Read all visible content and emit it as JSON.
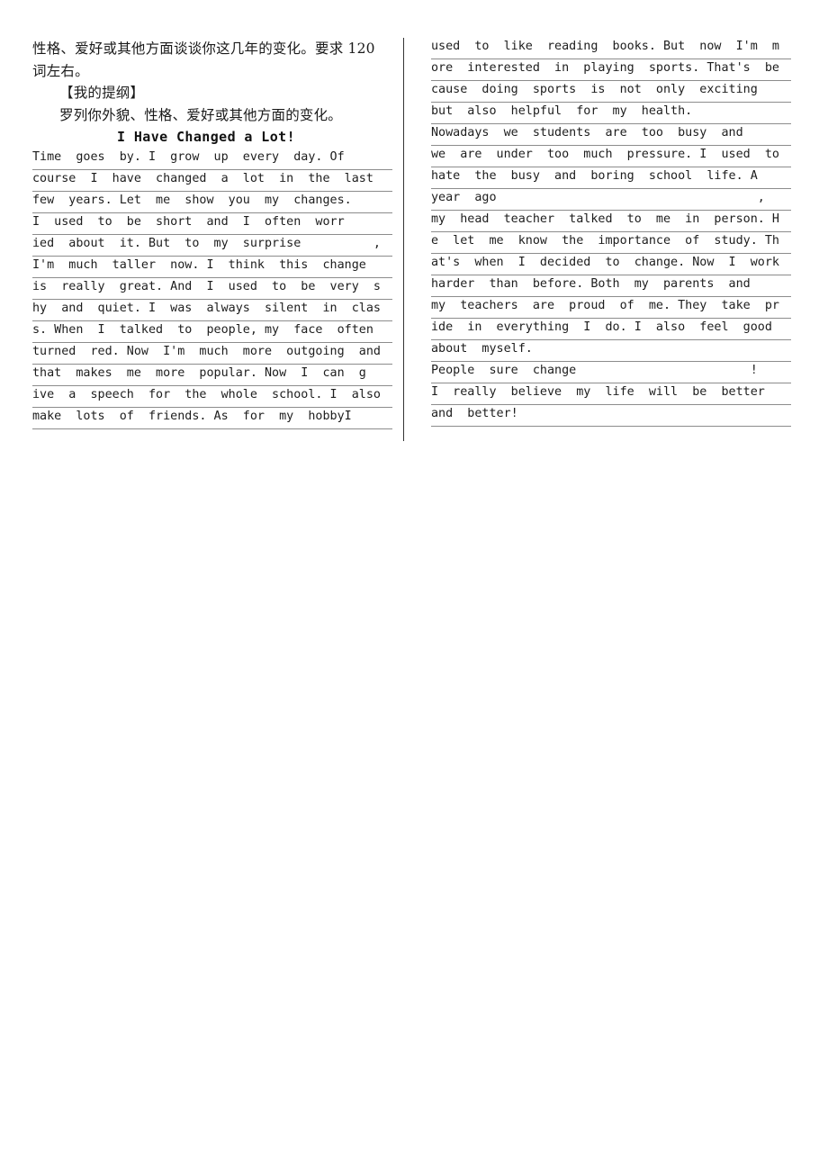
{
  "document": {
    "prompt": {
      "lines": [
        "性格、爱好或其他方面谈谈你这几年的变化。要求 120",
        "词左右。"
      ],
      "outline_heading": "【我的提纲】",
      "outline_text": "罗列你外貌、性格、爱好或其他方面的变化。"
    },
    "essay_title": "I Have Changed a Lot!",
    "left_column_lines": [
      "Time  goes  by. I  grow  up  every  day. Of",
      "course  I  have  changed  a  lot  in  the  last",
      "few  years. Let  me  show  you  my  changes.",
      "I  used  to  be  short  and  I  often  worr",
      "ied  about  it. But  to  my  surprise          ,",
      "I'm  much  taller  now. I  think  this  change",
      "is  really  great. And  I  used  to  be  very  s",
      "hy  and  quiet. I  was  always  silent  in  clas",
      "s. When  I  talked  to  people, my  face  often",
      "turned  red. Now  I'm  much  more  outgoing  and",
      "that  makes  me  more  popular. Now  I  can  g",
      "ive  a  speech  for  the  whole  school. I  also",
      "make  lots  of  friends. As  for  my  hobbyI"
    ],
    "right_column_lines": [
      "used  to  like  reading  books. But  now  I'm  m",
      "ore  interested  in  playing  sports. That's  be",
      "cause  doing  sports  is  not  only  exciting",
      "but  also  helpful  for  my  health.",
      "Nowadays  we  students  are  too  busy  and",
      "we  are  under  too  much  pressure. I  used  to",
      "hate  the  busy  and  boring  school  life. A",
      "year  ago                                    ,",
      "my  head  teacher  talked  to  me  in  person. H",
      "e  let  me  know  the  importance  of  study. Th",
      "at's  when  I  decided  to  change. Now  I  work",
      "harder  than  before. Both  my  parents  and",
      "my  teachers  are  proud  of  me. They  take  pr",
      "ide  in  everything  I  do. I  also  feel  good",
      "about  myself.",
      "People  sure  change                        !",
      "I  really  believe  my  life  will  be  better",
      "and  better!"
    ],
    "colors": {
      "text": "#1a1a1a",
      "rule": "#8c8c8c",
      "divider": "#333333",
      "page_background": "#ffffff"
    }
  }
}
